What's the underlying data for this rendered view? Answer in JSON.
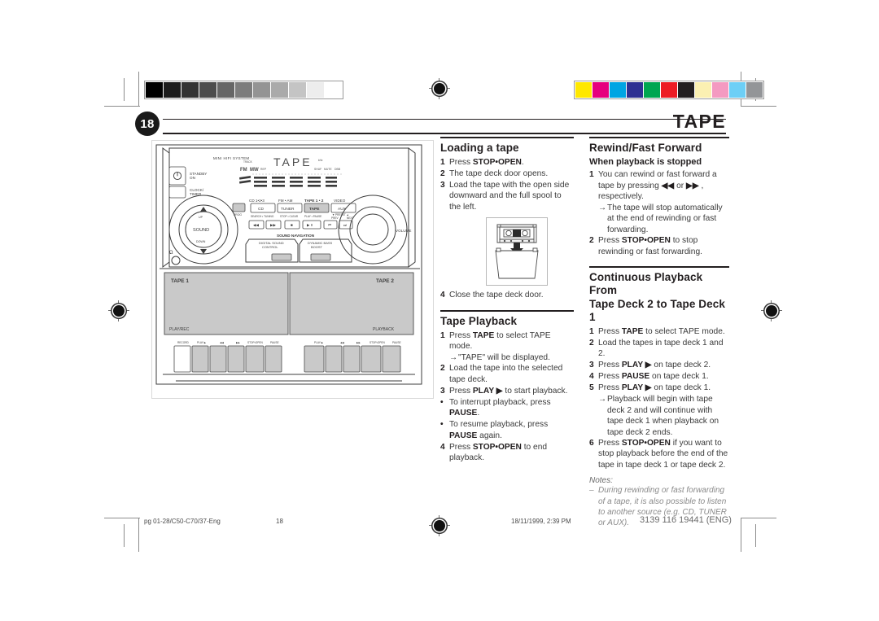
{
  "header": {
    "page_number": "18",
    "chapter_title": "TAPE"
  },
  "loading": {
    "heading": "Loading a tape",
    "steps": [
      {
        "num": "1",
        "html": "Press <b>STOP•OPEN</b>."
      },
      {
        "num": "2",
        "html": "The tape deck door opens."
      },
      {
        "num": "3",
        "html": "Load the tape with the open side downward and the full spool to the left."
      }
    ],
    "step4": {
      "num": "4",
      "html": "Close the tape deck door."
    },
    "illustration_alt": "cassette being loaded into open tape deck door"
  },
  "playback": {
    "heading": "Tape Playback",
    "steps": [
      {
        "num": "1",
        "html": "Press <b>TAPE</b> to select TAPE mode."
      },
      {
        "num": "2",
        "html": "Load the tape into the selected tape deck."
      },
      {
        "num": "3",
        "html": "Press <b>PLAY ▶</b> to start playback."
      }
    ],
    "arrow1": "→ \"TAPE\" will be displayed.",
    "bullets": [
      {
        "num": "•",
        "html": "To interrupt playback, press <b>PAUSE</b>."
      },
      {
        "num": "•",
        "html": "To resume playback, press <b>PAUSE</b> again."
      }
    ],
    "step4": {
      "num": "4",
      "html": "Press <b>STOP•OPEN</b> to end playback."
    }
  },
  "rewind": {
    "heading": "Rewind/Fast Forward",
    "subheading": "When playback is stopped",
    "steps": [
      {
        "num": "1",
        "html": "You can rewind or fast forward a tape by pressing <b>◀◀</b> or <b>▶▶</b> , respectively."
      },
      {
        "num": "2",
        "html": "Press <b>STOP•OPEN</b> to stop rewinding or fast forwarding."
      }
    ],
    "arrow1": "→ The tape will stop automatically at the end of rewinding or fast forwarding."
  },
  "continuous": {
    "heading_line1": "Continuous Playback From",
    "heading_line2": "Tape Deck 2 to Tape Deck 1",
    "steps": [
      {
        "num": "1",
        "html": "Press <b>TAPE</b> to select TAPE mode."
      },
      {
        "num": "2",
        "html": "Load the tapes in tape deck 1 and 2."
      },
      {
        "num": "3",
        "html": "Press <b>PLAY ▶</b> on tape deck 2."
      },
      {
        "num": "4",
        "html": "Press <b>PAUSE</b> on tape deck 1."
      },
      {
        "num": "5",
        "html": "Press <b>PLAY ▶</b> on tape deck 1."
      }
    ],
    "arrow1": "→ Playback will begin with tape deck 2 and will continue with tape deck 1 when playback on tape deck 2 ends.",
    "step6": {
      "num": "6",
      "html": "Press <b>STOP•OPEN</b> if you want to stop playback before the end of the tape in tape deck 1 or tape deck 2."
    },
    "notes_label": "Notes:",
    "notes": [
      {
        "dash": "–",
        "text": "During rewinding or fast forwarding of a tape, it is also possible to listen to another source (e.g. CD, TUNER or AUX)."
      }
    ]
  },
  "stereo": {
    "brand": "MINI HIFI SYSTEM",
    "display_text": "TAPE",
    "power_label_line1": "STANDBY",
    "power_label_line2": "ON",
    "clock_label_line1": "CLOCK/",
    "clock_label_line2": "TIMER",
    "source_row_labels": [
      "CD 1•2•3",
      "FM • AM",
      "TAPE 1 • 2",
      "VIDEO"
    ],
    "source_buttons": [
      "CD",
      "TUNER",
      "TAPE",
      "AUX"
    ],
    "prog_label": "PROG",
    "transport_group_labels": [
      "SEARCH • TUNING",
      "STOP • CLEAR",
      "PLAY • PAUSE",
      "PRESET •",
      "PREV",
      "NEXT"
    ],
    "transport_icons": [
      "◀◀",
      "▶▶",
      "■",
      "▶ II",
      "⏮",
      "⏭"
    ],
    "sound_knob_label": "SOUND",
    "sound_up": "UP",
    "sound_down": "DOWN",
    "volume_label": "VOLUME",
    "sound_nav_label": "SOUND NAVIGATION",
    "dsc_label_line1": "DIGITAL SOUND",
    "dsc_label_line2": "CONTROL",
    "dbb_label_line1": "DYNAMIC BASS",
    "dbb_label_line2": "BOOST",
    "deck1_title": "TAPE 1",
    "deck1_mode": "PLAY/REC",
    "deck2_title": "TAPE 2",
    "deck2_mode": "PLAYBACK",
    "deck1_buttons": [
      "RECORD",
      "PLAY ▶",
      "◀◀",
      "▶▶",
      "STOP•OPEN",
      "PAUSE"
    ],
    "deck2_buttons": [
      "PLAY ▶",
      "◀◀",
      "▶▶",
      "STOP•OPEN",
      "PAUSE"
    ]
  },
  "footer": {
    "filename": "pg 01-28/C50-C70/37-Eng",
    "page": "18",
    "timestamp": "18/11/1999, 2:39 PM",
    "document_code": "3139 116 19441 (ENG)"
  },
  "calibration": {
    "grayscale": [
      "#000000",
      "#1c1c1c",
      "#333333",
      "#4d4d4d",
      "#666666",
      "#7d7d7d",
      "#949494",
      "#aaaaaa",
      "#c4c4c4",
      "#ededed",
      "#ffffff"
    ],
    "colors": [
      "#ffe800",
      "#e6007e",
      "#00a5e3",
      "#2e3192",
      "#00a651",
      "#ed1c24",
      "#231f20",
      "#fbf0b2",
      "#f49ac1",
      "#6dcff6",
      "#939598"
    ]
  }
}
